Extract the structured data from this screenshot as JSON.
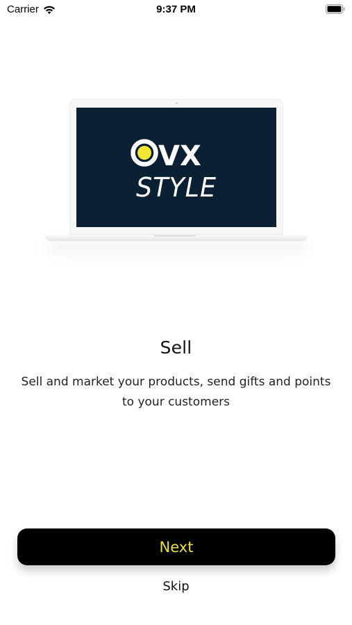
{
  "status_bar": {
    "carrier": "Carrier",
    "time": "9:37 PM",
    "wifi_icon": "wifi-icon",
    "battery_icon": "battery-icon"
  },
  "illustration": {
    "logo_primary": "OVX",
    "logo_secondary": "STYLE",
    "screen_color": "#0b2133",
    "logo_dot_color": "#f3e533"
  },
  "slide": {
    "title": "Sell",
    "description": "Sell and market your products, send gifts and points to your customers"
  },
  "actions": {
    "next_label": "Next",
    "skip_label": "Skip",
    "next_text_color": "#e9e13a"
  }
}
